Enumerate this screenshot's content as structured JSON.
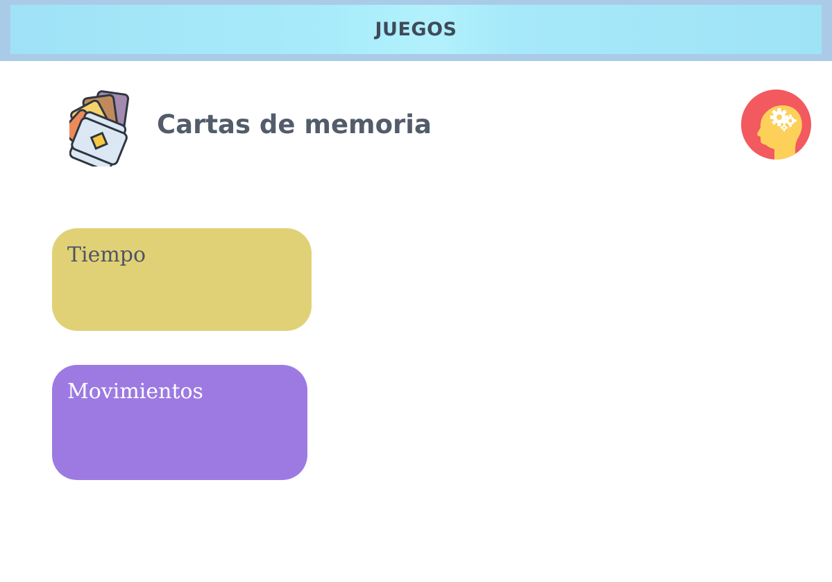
{
  "header": {
    "title": "JUEGOS"
  },
  "game": {
    "title": "Cartas de memoria",
    "icon": "memory-cards-icon",
    "action_icon": "brain-gears-icon"
  },
  "stats": {
    "time": {
      "label": "Tiempo",
      "value": ""
    },
    "moves": {
      "label": "Movimientos",
      "value": ""
    }
  },
  "colors": {
    "banner_frame": "#aacbe8",
    "banner_fill": "#a8ecfb",
    "title_text": "#525c6a",
    "time_card": "#e1d176",
    "moves_card": "#9d7ae2",
    "brain_button": "#f25a5f",
    "brain_head": "#fdd05a"
  }
}
